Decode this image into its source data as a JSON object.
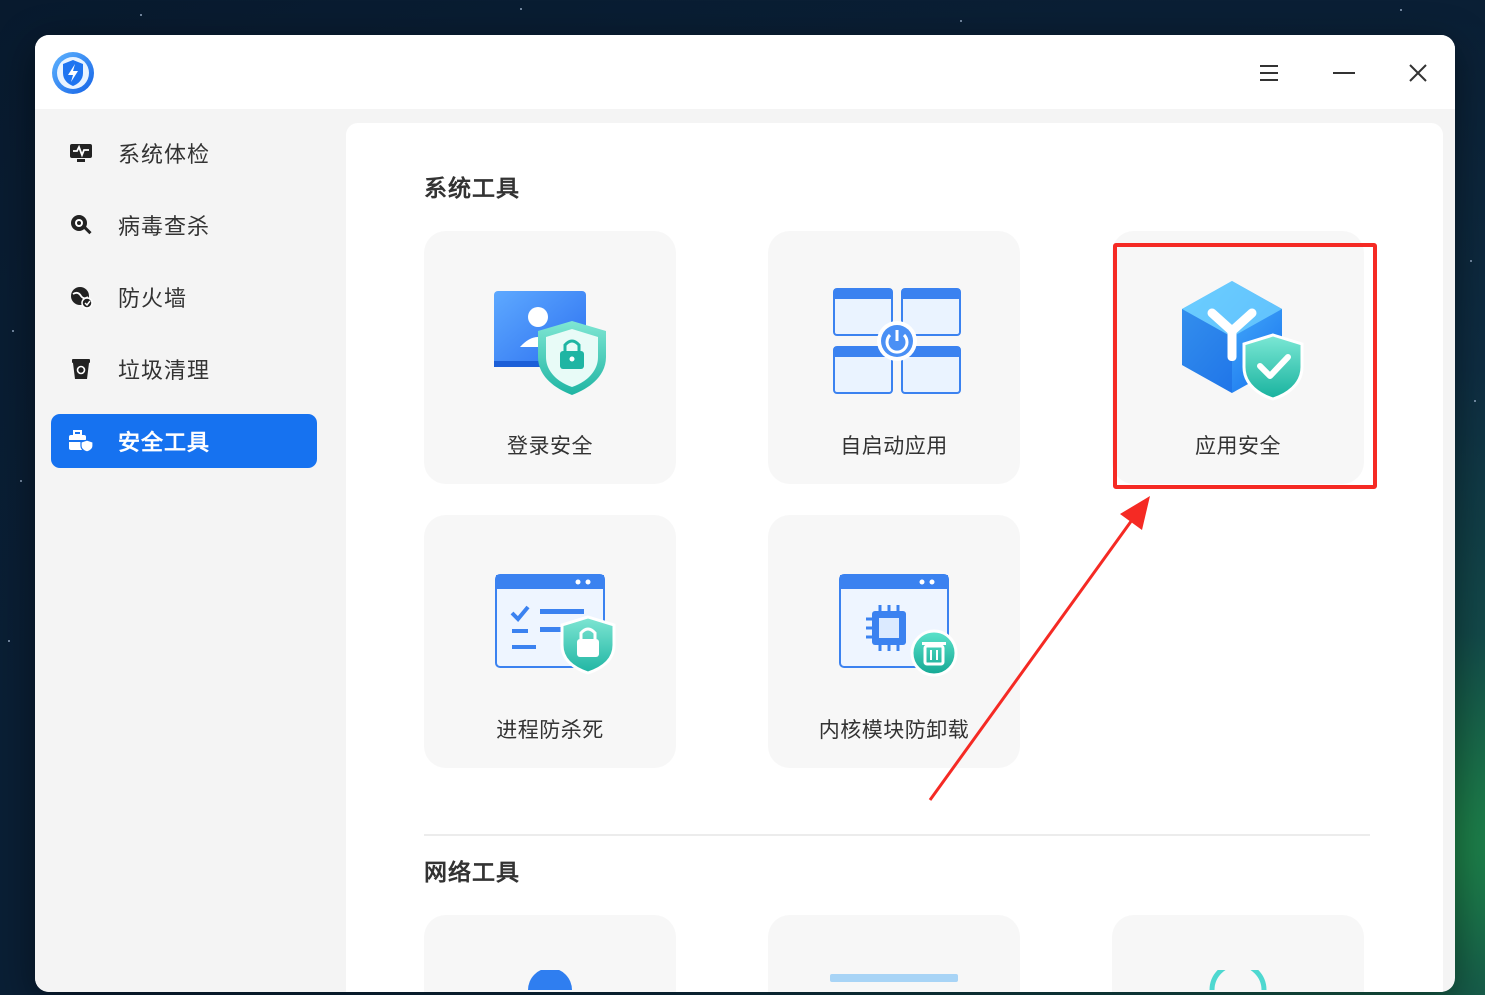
{
  "sidebar": {
    "items": [
      {
        "label": "系统体检",
        "icon": "monitor-pulse-icon",
        "active": false
      },
      {
        "label": "病毒查杀",
        "icon": "magnifier-virus-icon",
        "active": false
      },
      {
        "label": "防火墙",
        "icon": "firewall-globe-icon",
        "active": false
      },
      {
        "label": "垃圾清理",
        "icon": "trash-bin-icon",
        "active": false
      },
      {
        "label": "安全工具",
        "icon": "toolbox-shield-icon",
        "active": true
      }
    ]
  },
  "sections": {
    "system_tools": {
      "title": "系统工具",
      "cards": [
        {
          "label": "登录安全",
          "icon": "login-security-icon"
        },
        {
          "label": "自启动应用",
          "icon": "autostart-apps-icon"
        },
        {
          "label": "应用安全",
          "icon": "app-security-icon"
        },
        {
          "label": "进程防杀死",
          "icon": "process-protection-icon"
        },
        {
          "label": "内核模块防卸载",
          "icon": "kernel-module-protection-icon"
        }
      ]
    },
    "network_tools": {
      "title": "网络工具"
    }
  },
  "colors": {
    "accent": "#1672f0",
    "highlight": "#f52a24"
  }
}
